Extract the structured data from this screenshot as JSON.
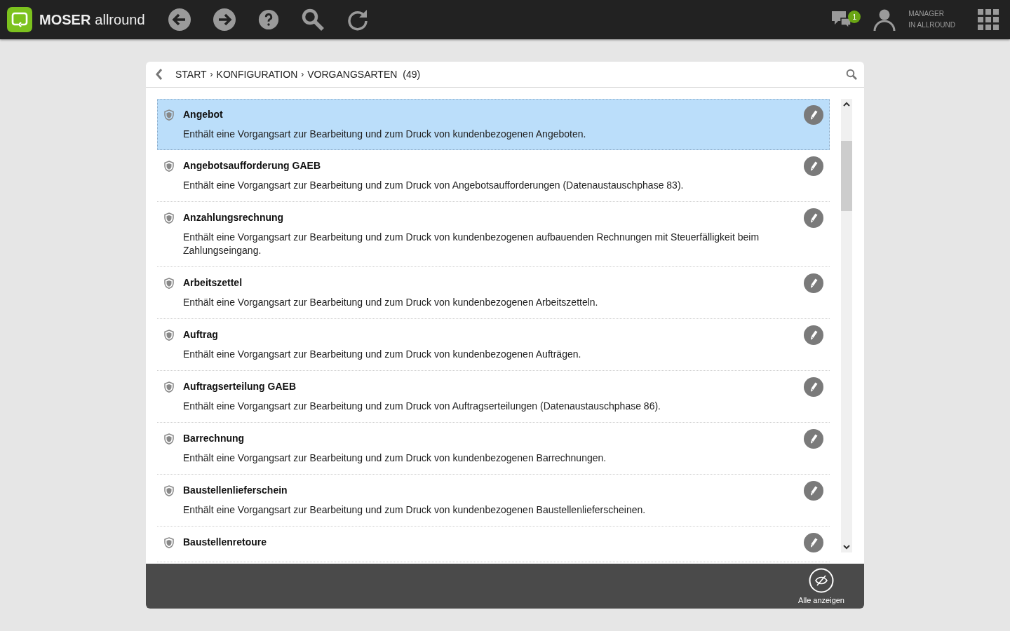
{
  "topbar": {
    "brand_bold": "MOSER",
    "brand_light": "allround",
    "notification_count": "1",
    "user_line1": "MANAGER",
    "user_line2": "IN ALLROUND"
  },
  "breadcrumb": {
    "items": [
      "START",
      "KONFIGURATION",
      "VORGANGSARTEN"
    ],
    "separator": "›",
    "count": "(49)"
  },
  "rows": [
    {
      "title": "Angebot",
      "description": "Enthält eine Vorgangsart zur Bearbeitung und zum Druck von kundenbezogenen Angeboten.",
      "selected": true
    },
    {
      "title": "Angebotsaufforderung GAEB",
      "description": "Enthält eine Vorgangsart zur Bearbeitung und zum Druck von Angebotsaufforderungen (Datenaustauschphase 83).",
      "selected": false
    },
    {
      "title": "Anzahlungsrechnung",
      "description": "Enthält eine Vorgangsart zur Bearbeitung und zum Druck von kundenbezogenen aufbauenden Rechnungen mit Steuerfälligkeit beim Zahlungseingang.",
      "selected": false
    },
    {
      "title": "Arbeitszettel",
      "description": "Enthält eine Vorgangsart zur Bearbeitung und zum Druck von kundenbezogenen Arbeitszetteln.",
      "selected": false
    },
    {
      "title": "Auftrag",
      "description": "Enthält eine Vorgangsart zur Bearbeitung und zum Druck von kundenbezogenen Aufträgen.",
      "selected": false
    },
    {
      "title": "Auftragserteilung GAEB",
      "description": "Enthält eine Vorgangsart zur Bearbeitung und zum Druck von Auftragserteilungen (Datenaustauschphase 86).",
      "selected": false
    },
    {
      "title": "Barrechnung",
      "description": "Enthält eine Vorgangsart zur Bearbeitung und zum Druck von kundenbezogenen Barrechnungen.",
      "selected": false
    },
    {
      "title": "Baustellenlieferschein",
      "description": "Enthält eine Vorgangsart zur Bearbeitung und zum Druck von kundenbezogenen Baustellenlieferscheinen.",
      "selected": false
    },
    {
      "title": "Baustellenretoure",
      "selected": false
    }
  ],
  "footer": {
    "show_all_label": "Alle anzeigen"
  }
}
